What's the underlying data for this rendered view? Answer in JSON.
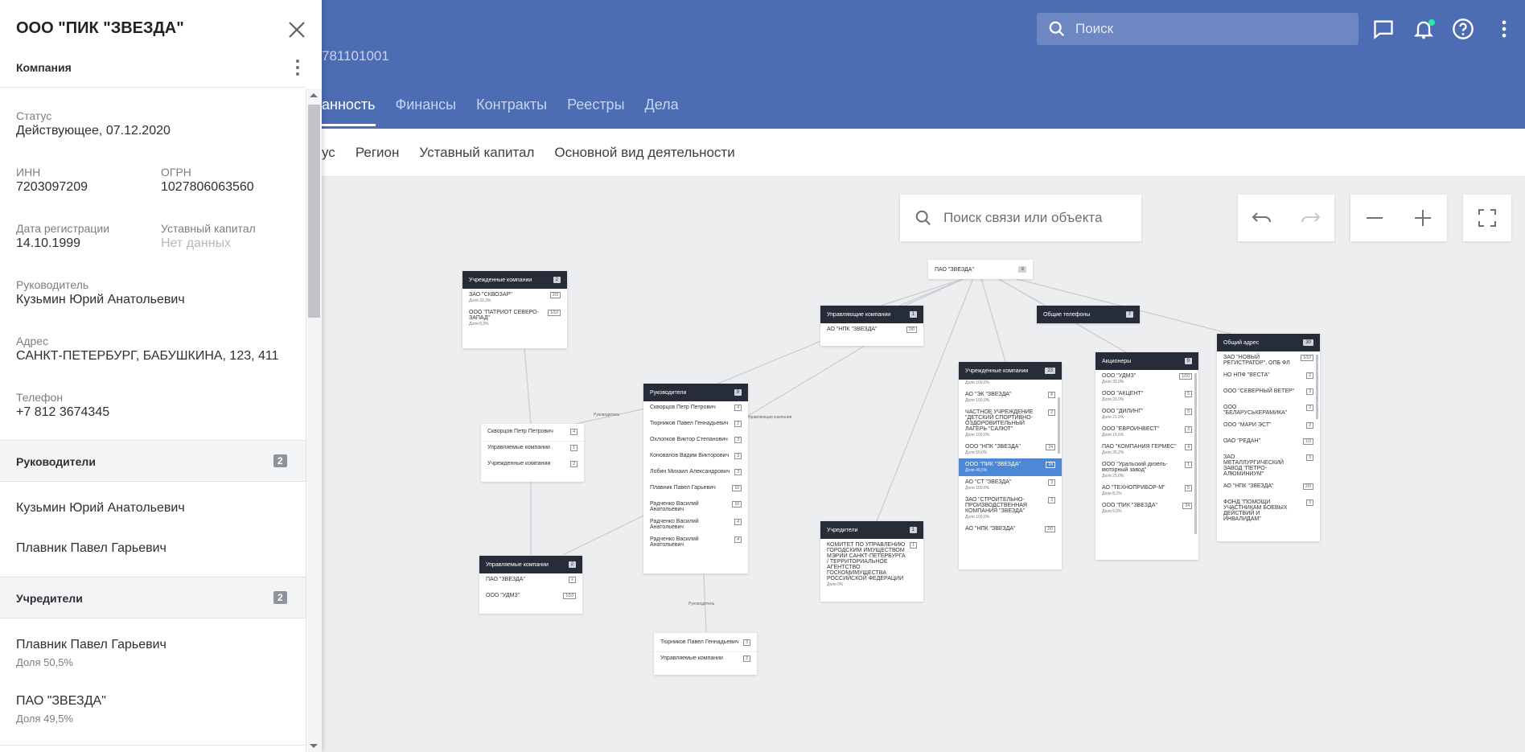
{
  "header": {
    "subtitle_fragment": "781101001",
    "search_placeholder": "Поиск",
    "tabs": [
      {
        "label": "анность"
      },
      {
        "label": "Финансы"
      },
      {
        "label": "Контракты"
      },
      {
        "label": "Реестры"
      },
      {
        "label": "Дела"
      }
    ],
    "accent": "#4c6cb4"
  },
  "filterbar": {
    "items": [
      {
        "label": "ус"
      },
      {
        "label": "Регион"
      },
      {
        "label": "Уставный капитал"
      },
      {
        "label": "Основной вид деятельности"
      }
    ]
  },
  "graph": {
    "search_placeholder": "Поиск связи или объекта",
    "nodes": {
      "root": {
        "label": "ПАО \"ЗВЕЗДА\"",
        "badge": "≡"
      },
      "founded_left": {
        "title": "Учрежденные компании",
        "count": "2",
        "rows": [
          {
            "name": "ЗАО \"СКВОЗАР\"",
            "share": "Доля 33,3%",
            "badge": "2/3"
          },
          {
            "name": "ООО \"ПАТРИОТ СЕВЕРО-ЗАПАД\"",
            "share": "Доля 8,3%",
            "badge": "1/10"
          }
        ]
      },
      "managing": {
        "title": "Управляющие компании",
        "count": "1",
        "rows": [
          {
            "name": "АО \"НПК \"ЗВЕЗДА\"",
            "badge": "2/0"
          }
        ]
      },
      "phones": {
        "title": "Общие телефоны",
        "count": "7"
      },
      "person": {
        "name": "Скворцов Петр Петрович",
        "badge": "4",
        "rows": [
          {
            "name": "Управляемые компании",
            "badge": "1"
          },
          {
            "name": "Учрежденные компании",
            "badge": "2"
          }
        ]
      },
      "managers": {
        "title": "Руководители",
        "count": "9",
        "rows": [
          {
            "name": "Скворцов Петр Петрович",
            "badge": "4"
          },
          {
            "name": "Тюрников Павел Геннадьевич",
            "badge": "2"
          },
          {
            "name": "Охлопков Виктор Степанович",
            "badge": "3"
          },
          {
            "name": "Коновалов Вадим Викторович",
            "badge": "3"
          },
          {
            "name": "Лобин Михаил Александрович",
            "badge": "3"
          },
          {
            "name": "Плавник Павел Гарьевич",
            "badge": "10"
          },
          {
            "name": "Радченко Василий Анатольевич",
            "badge": "10"
          },
          {
            "name": "Радченко Василий Анатольевич",
            "badge": "4"
          },
          {
            "name": "Радченко Василий Анатольевич",
            "badge": "4"
          }
        ]
      },
      "managed_bottom": {
        "title": "Управляемые компании",
        "count": "2",
        "rows": [
          {
            "name": "ПАО \"ЗВЕЗДА\"",
            "badge": "≡"
          },
          {
            "name": "ООО \"УДМЗ\"",
            "badge": "1/10"
          }
        ]
      },
      "person2": {
        "rows": [
          {
            "name": "Тюрников Павел Геннадьевич",
            "badge": "3"
          },
          {
            "name": "Управляемые компании",
            "badge": "2"
          }
        ]
      },
      "founders": {
        "title": "Учредители",
        "count": "1",
        "rows": [
          {
            "name": "КОМИТЕТ ПО УПРАВЛЕНИЮ ГОРОДСКИМ ИМУЩЕСТВОМ МЭРИИ САНКТ-ПЕТЕРБУРГА / ТЕРРИТОРИАЛЬНОЕ АГЕНТСТВО ГОСКОМИМУЩЕСТВА РОССИЙСКОЙ ФЕДЕРАЦИИ",
            "share": "Доля 0%",
            "badge": "1"
          }
        ]
      },
      "founded_mid": {
        "title": "Учрежденные компании",
        "count": "23",
        "rows": [
          {
            "name": "Доля 100,0%",
            "share": "",
            "badge": ""
          },
          {
            "name": "АО \"ЭК \"ЗВЕЗДА\"",
            "share": "Доля 100,0%",
            "badge": "8"
          },
          {
            "name": "ЧАСТНОЕ УЧРЕЖДЕНИЕ \"ДЕТСКИЙ СПОРТИВНО-ОЗДОРОВИТЕЛЬНЫЙ ЛАГЕРЬ \"САЛЮТ\"",
            "share": "Доля 100,0%",
            "badge": "2"
          },
          {
            "name": "ООО \"НПК \"ЗВЕЗДА\"",
            "share": "Доля 50,0%",
            "badge": "24"
          },
          {
            "name": "ООО \"ПИК \"ЗВЕЗДА\"",
            "share": "Доля 49,5%",
            "badge": "24",
            "selected": true
          },
          {
            "name": "АО \"СТ \"ЗВЕЗДА\"",
            "share": "Доля 100,0%",
            "badge": "3"
          },
          {
            "name": "ЗАО \"СТРОИТЕЛЬНО-ПРОИЗВОДСТВЕННАЯ КОМПАНИЯ \"ЗВЕЗДА\"",
            "share": "Доля 100,0%",
            "badge": "3"
          },
          {
            "name": "АО \"НПК \"ЗВЕЗДА\"",
            "share": "",
            "badge": "2/0"
          }
        ]
      },
      "shareholders": {
        "title": "Акционеры",
        "count": "9",
        "rows": [
          {
            "name": "ООО \"УДМЗ\"",
            "share": "Доля 33,0%",
            "badge": "1/10"
          },
          {
            "name": "ООО \"АКЦЕНТ\"",
            "share": "Доля 23,0%",
            "badge": "5"
          },
          {
            "name": "ООО \"ДИЛИНГ\"",
            "share": "Доля 21,0%",
            "badge": "5"
          },
          {
            "name": "ООО \"ЕВРОИНВЕСТ\"",
            "share": "Доля 15,6%",
            "badge": "3"
          },
          {
            "name": "ПАО \"КОМПАНИЯ ГЕРМЕС\"",
            "share": "Доля 26,2%",
            "badge": "4"
          },
          {
            "name": "ООО \"Уральский дизель-моторный завод\"",
            "share": "Доля 23,0%",
            "badge": "1"
          },
          {
            "name": "АО \"ТЕХНОПРИБОР-М\"",
            "share": "Доля 8,2%",
            "badge": "5"
          },
          {
            "name": "ООО \"ПИК \"ЗВЕЗДА\"",
            "share": "Доля 5,0%",
            "badge": "24"
          }
        ]
      },
      "address": {
        "title": "Общий адрес",
        "count": "30",
        "rows": [
          {
            "name": "ЗАО \"НОВЫЙ РЕГИСТРАТОР\", ОПБ ФЛ",
            "badge": "1/10"
          },
          {
            "name": "НО НПФ \"ВЕСТА\"",
            "badge": "2"
          },
          {
            "name": "ООО \"СЕВЕРНЫЙ ВЕТЕР\"",
            "badge": "3"
          },
          {
            "name": "ООО \"БЕЛАРУСЬКЕРАМИКА\"",
            "badge": "3"
          },
          {
            "name": "ООО \"МАРИ ЭСТ\"",
            "badge": "2"
          },
          {
            "name": "ОАО \"РЕДАН\"",
            "badge": "1/2"
          },
          {
            "name": "ЗАО МЕТАЛЛУРГИЧЕСКИЙ ЗАВОД \"ПЕТРО-АЛЮМИНИУМ\"",
            "badge": "3"
          },
          {
            "name": "АО \"НПК \"ЗВЕЗДА\"",
            "badge": "2/0"
          },
          {
            "name": "ФОНД \"ПОМОЩИ УЧАСТНИКАМ БОЕВЫХ ДЕЙСТВИЙ И ИНВАЛИДАМ\"",
            "badge": "3"
          }
        ]
      }
    },
    "edge_labels": {
      "managers_edge": "Руководитель",
      "managing_edge": "Управляющая компания",
      "bottom_edge": "Руководитель"
    }
  },
  "panel": {
    "title": "ООО \"ПИК \"ЗВЕЗДА\"",
    "section": "Компания",
    "status_label": "Статус",
    "status_value": "Действующее, 07.12.2020",
    "inn_label": "ИНН",
    "inn_value": "7203097209",
    "ogrn_label": "ОГРН",
    "ogrn_value": "1027806063560",
    "regdate_label": "Дата регистрации",
    "regdate_value": "14.10.1999",
    "capital_label": "Уставный капитал",
    "capital_value": "Нет данных",
    "head_label": "Руководитель",
    "head_value": "Кузьмин Юрий Анатольевич",
    "address_label": "Адрес",
    "address_value": "САНКТ-ПЕТЕРБУРГ, БАБУШКИНА, 123, 411",
    "phone_label": "Телефон",
    "phone_value": "+7 812 3674345",
    "managers_title": "Руководители",
    "managers_count": "2",
    "managers": [
      "Кузьмин Юрий Анатольевич",
      "Плавник Павел Гарьевич"
    ],
    "founders_title": "Учредители",
    "founders_count": "2",
    "founders": [
      {
        "name": "Плавник Павел Гарьевич",
        "share": "Доля 50,5%"
      },
      {
        "name": "ПАО \"ЗВЕЗДА\"",
        "share": "Доля 49,5%"
      }
    ]
  }
}
